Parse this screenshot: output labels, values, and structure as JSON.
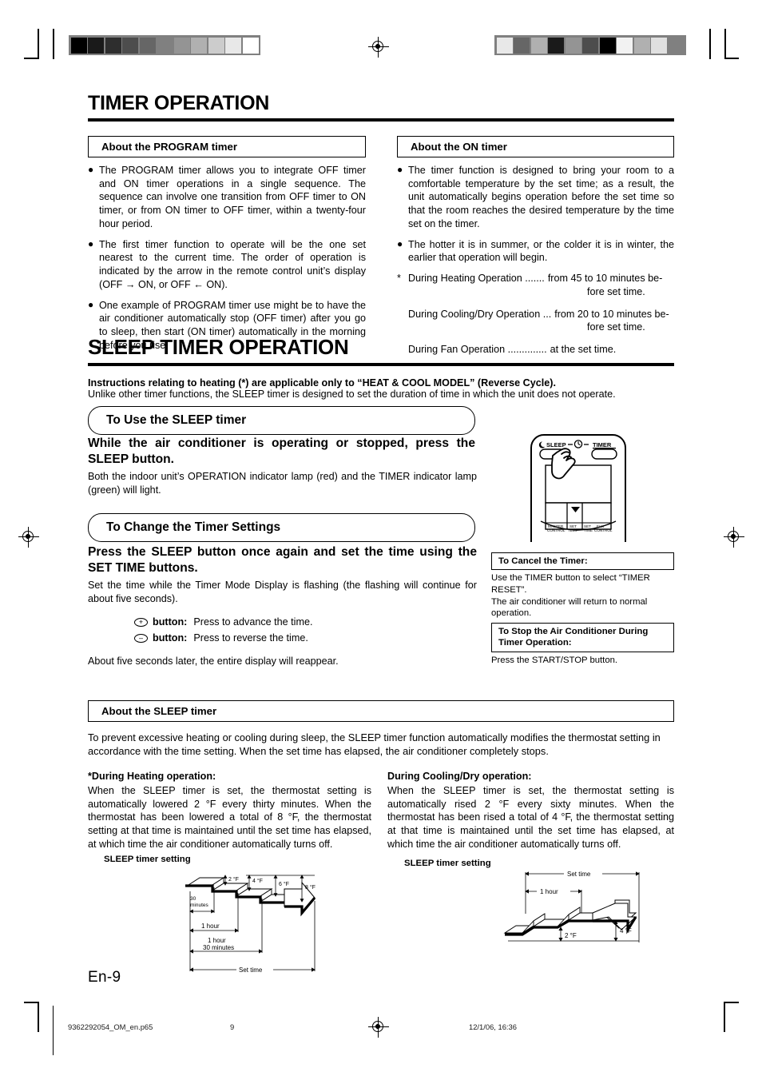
{
  "document": {
    "page_label": "En-9",
    "footer": {
      "file": "9362292054_OM_en.p65",
      "page": "9",
      "timestamp": "12/1/06, 16:36"
    }
  },
  "section1": {
    "title": "TIMER OPERATION",
    "program_box": {
      "heading": "About the PROGRAM timer",
      "bullets": [
        "The PROGRAM timer allows you to integrate OFF timer and ON timer operations in a single sequence. The sequence can involve one transition from OFF timer to ON timer, or from ON timer to OFF timer, within a twenty-four hour period.",
        "The first timer function to operate will be the one set nearest to the current time. The order of operation is indicated by the arrow in the remote control unit’s display (OFF → ON, or OFF ← ON).",
        "One example of PROGRAM timer use might be to have the air conditioner automatically stop (OFF timer) after you go to sleep, then start (ON timer) automatically in the morning before you rise."
      ]
    },
    "on_box": {
      "heading": "About the ON timer",
      "bullets": [
        "The timer function is designed to bring your room to a comfortable temperature by the set time; as a result, the unit automatically begins operation before the set time so that the room reaches the desired temperature by the time set on the timer.",
        "The hotter it is in summer, or the colder it is in winter, the earlier that operation will begin."
      ],
      "note_marker": "*",
      "rows": [
        {
          "label": "During Heating Operation .......",
          "value": "from 45 to 10 minutes be-",
          "value2": "fore set time."
        },
        {
          "label": "During Cooling/Dry Operation ...",
          "value": "from 20 to 10 minutes be-",
          "value2": "fore set time."
        },
        {
          "label": "During Fan Operation ..............",
          "value": "at the set time.",
          "value2": ""
        }
      ]
    }
  },
  "section2": {
    "title": "SLEEP TIMER OPERATION",
    "intro_bold": "Instructions relating to heating (*) are applicable only to “HEAT & COOL MODEL” (Reverse Cycle).",
    "intro_text": "Unlike other timer functions, the SLEEP timer is designed to set the duration of time in which the unit does not operate.",
    "use_box": {
      "heading": "To Use the SLEEP timer",
      "instruction": "While the air conditioner is operating or stopped, press the SLEEP button.",
      "detail": "Both the indoor unit’s OPERATION indicator lamp (red) and the TIMER indicator lamp (green) will light."
    },
    "change_box": {
      "heading": "To Change the Timer Settings",
      "instruction": "Press the SLEEP button once again and set the time using the SET TIME buttons.",
      "detail": "Set the time while the Timer Mode Display is flashing (the flashing will continue for about five seconds).",
      "plus_glyph": "+",
      "plus_label": "button:",
      "plus_text": "Press to advance the time.",
      "minus_glyph": "–",
      "minus_label": "button:",
      "minus_text": "Press to reverse the time.",
      "closing": "About five seconds later, the entire display will reappear."
    },
    "remote": {
      "sleep_label": "SLEEP",
      "timer_label": "TIMER",
      "buttons": [
        "MASTER CONTROL",
        "SET TEMP",
        "SET TIME",
        "FAN CONTROL"
      ]
    },
    "cancel_box": {
      "heading": "To Cancel the Timer:",
      "body": "Use the TIMER button to select “TIMER RESET”.\nThe air conditioner will return to normal operation."
    },
    "stop_box": {
      "heading": "To Stop the Air Conditioner During Timer Operation:",
      "body": "Press the START/STOP button."
    },
    "about_box": {
      "heading": "About the SLEEP timer",
      "body": "To prevent excessive heating or cooling during sleep, the SLEEP timer function automatically modifies the thermostat setting in accordance with the time setting. When the set time has elapsed, the air conditioner completely stops."
    },
    "heating": {
      "heading": "*During Heating operation:",
      "body": "When the SLEEP timer is set, the thermostat setting is automatically lowered 2 °F every thirty minutes. When the thermostat has been lowered a total of 8 °F, the thermostat setting at that time is maintained until the set time has elapsed, at which time the air conditioner automatically turns off."
    },
    "cooling": {
      "heading": "During Cooling/Dry operation:",
      "body": "When the SLEEP timer is set, the thermostat setting is automatically rised 2 °F every sixty minutes. When the thermostat has been rised a total of 4 °F, the thermostat setting at that time is maintained until the set time has elapsed, at which time the air conditioner automatically turns off."
    },
    "diagram_heating": {
      "caption": "SLEEP timer setting",
      "temp_labels": [
        "2 °F",
        "4 °F",
        "6 °F",
        "8 °F"
      ],
      "time_labels": [
        "30 minutes",
        "1 hour",
        "1 hour 30 minutes",
        "Set time"
      ]
    },
    "diagram_cooling": {
      "caption": "SLEEP timer setting",
      "temp_labels": [
        "2 °F",
        "4 °F"
      ],
      "time_labels": [
        "Set time",
        "1 hour"
      ]
    }
  },
  "calibration": {
    "left_strip": [
      "#000000",
      "#1a1a1a",
      "#2e2e2e",
      "#4d4d4d",
      "#666666",
      "#808080",
      "#949494",
      "#b0b0b0",
      "#cccccc",
      "#e8e8e8",
      "#ffffff"
    ],
    "right_strip": [
      "#e8e8e8",
      "#666666",
      "#b0b0b0",
      "#1a1a1a",
      "#949494",
      "#4d4d4d",
      "#000000",
      "#f2f2f2",
      "#b0b0b0",
      "#e0e0e0",
      "#808080"
    ]
  }
}
